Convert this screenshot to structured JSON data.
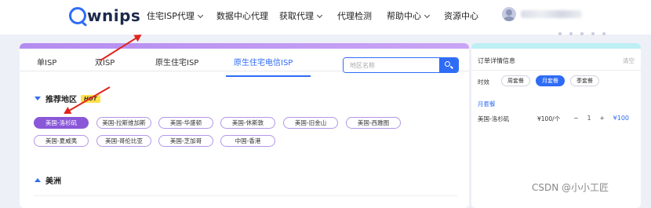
{
  "nav": {
    "logo_text": "wnips",
    "items": [
      "住宅ISP代理",
      "数据中心代理",
      "获取代理",
      "代理检测",
      "帮助中心",
      "资源中心"
    ]
  },
  "tabs": [
    "单ISP",
    "双ISP",
    "原生住宅ISP",
    "原生住宅电信ISP"
  ],
  "search": {
    "placeholder": "地区名称"
  },
  "recommended": {
    "title": "推荐地区",
    "badge": "HOT",
    "regions": [
      "美国-洛杉矶",
      "美国-拉斯维加斯",
      "美国-华盛顿",
      "美国-休斯敦",
      "美国-旧金山",
      "美国-西雅图",
      "美国-夏威夷",
      "美国-哥伦比亚",
      "美国-芝加哥",
      "中国-香港"
    ],
    "selected_index": 0
  },
  "americas": {
    "title": "美洲"
  },
  "order": {
    "title": "订单详情信息",
    "clear": "清空",
    "period_label": "时效",
    "periods": [
      "周套餐",
      "月套餐",
      "季套餐"
    ],
    "active_period_index": 1,
    "plan_label": "月套餐",
    "item": {
      "region": "美国-洛杉矶",
      "price": "¥100/个",
      "minus": "−",
      "qty": "1",
      "plus": "+",
      "total": "¥100"
    }
  },
  "watermark": "CSDN @小小工匠",
  "colors": {
    "primary": "#2f6cf6",
    "purple": "#8a57d8",
    "arrow": "#e0231b"
  }
}
